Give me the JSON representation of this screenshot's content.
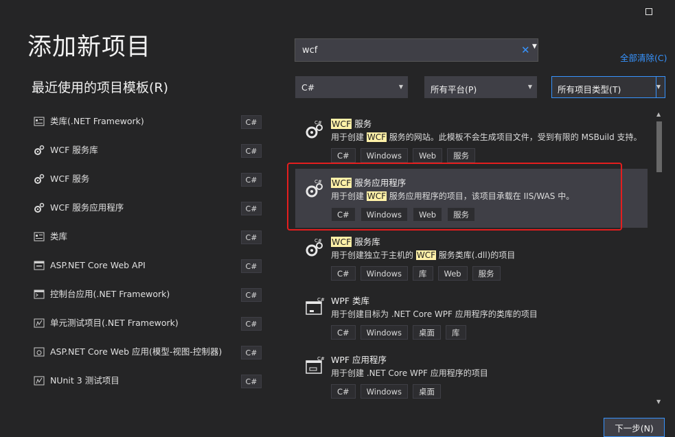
{
  "page_title": "添加新项目",
  "recent": {
    "title": "最近使用的项目模板(R)",
    "items": [
      {
        "name": "类库(.NET Framework)",
        "lang": "C#",
        "icon": "class-library-icon"
      },
      {
        "name": "WCF 服务库",
        "lang": "C#",
        "icon": "wcf-gear-icon"
      },
      {
        "name": "WCF 服务",
        "lang": "C#",
        "icon": "wcf-gear-icon"
      },
      {
        "name": "WCF 服务应用程序",
        "lang": "C#",
        "icon": "wcf-gear-icon"
      },
      {
        "name": "类库",
        "lang": "C#",
        "icon": "class-library-icon"
      },
      {
        "name": "ASP.NET Core Web API",
        "lang": "C#",
        "icon": "web-api-icon"
      },
      {
        "name": "控制台应用(.NET Framework)",
        "lang": "C#",
        "icon": "console-app-icon"
      },
      {
        "name": "单元测试项目(.NET Framework)",
        "lang": "C#",
        "icon": "test-project-icon"
      },
      {
        "name": "ASP.NET Core Web 应用(模型-视图-控制器)",
        "lang": "C#",
        "icon": "mvc-app-icon"
      },
      {
        "name": "NUnit 3 测试项目",
        "lang": "C#",
        "icon": "test-project-icon"
      }
    ]
  },
  "search": {
    "value": "wcf",
    "clear_glyph": "✕",
    "drop_glyph": "▼"
  },
  "clear_all": "全部清除(C)",
  "filters": {
    "language": "C#",
    "platform": "所有平台(P)",
    "project_type": "所有项目类型(T)"
  },
  "results": [
    {
      "hl": "WCF",
      "title_rest": " 服务",
      "desc_pre": "用于创建 ",
      "desc_hl": "WCF",
      "desc_post": " 服务的网站。此模板不会生成项目文件，受到有限的 MSBuild 支持。",
      "tags": [
        "C#",
        "Windows",
        "Web",
        "服务"
      ],
      "icon": "wcf-service-icon"
    },
    {
      "hl": "WCF",
      "title_rest": " 服务应用程序",
      "desc_pre": "用于创建 ",
      "desc_hl": "WCF",
      "desc_post": " 服务应用程序的项目，该项目承载在 IIS/WAS 中。",
      "tags": [
        "C#",
        "Windows",
        "Web",
        "服务"
      ],
      "icon": "wcf-service-icon",
      "selected": true
    },
    {
      "hl": "WCF",
      "title_rest": " 服务库",
      "desc_pre": "用于创建独立于主机的 ",
      "desc_hl": "WCF",
      "desc_post": " 服务类库(.dll)的项目",
      "tags": [
        "C#",
        "Windows",
        "库",
        "Web",
        "服务"
      ],
      "icon": "wcf-service-icon"
    },
    {
      "hl": "",
      "title_rest": "WPF 类库",
      "desc_pre": "用于创建目标为 .NET Core WPF 应用程序的类库的项目",
      "desc_hl": "",
      "desc_post": "",
      "tags": [
        "C#",
        "Windows",
        "桌面",
        "库"
      ],
      "icon": "wpf-library-icon"
    },
    {
      "hl": "",
      "title_rest": "WPF 应用程序",
      "desc_pre": "用于创建 .NET Core WPF 应用程序的项目",
      "desc_hl": "",
      "desc_post": "",
      "tags": [
        "C#",
        "Windows",
        "桌面"
      ],
      "icon": "wpf-app-icon"
    }
  ],
  "next_button": "下一步(N)",
  "colors": {
    "accent": "#3794ff",
    "highlight": "#fff1a8",
    "annotation": "#e51e1e",
    "background": "#252526"
  }
}
